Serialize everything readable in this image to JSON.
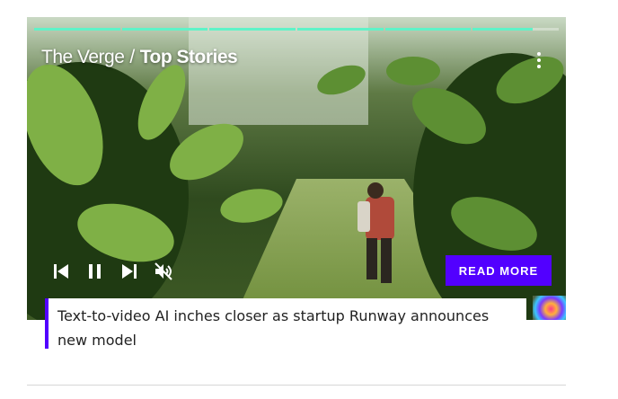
{
  "player": {
    "source_name": "The Verge",
    "separator": "/",
    "section": "Top Stories",
    "progress": {
      "segments_total": 6,
      "segments_complete": 5,
      "current_segment_fraction": 0.7
    },
    "controls": {
      "previous_icon": "skip-previous-icon",
      "pause_icon": "pause-icon",
      "next_icon": "skip-next-icon",
      "mute_icon": "volume-muted-icon"
    },
    "menu_icon": "kebab-menu-icon",
    "read_more_label": "READ MORE",
    "headline": "Text-to-video AI inches closer as startup Runway announces new model"
  },
  "colors": {
    "accent": "#5200ff",
    "progress": "#5ff3c8"
  }
}
